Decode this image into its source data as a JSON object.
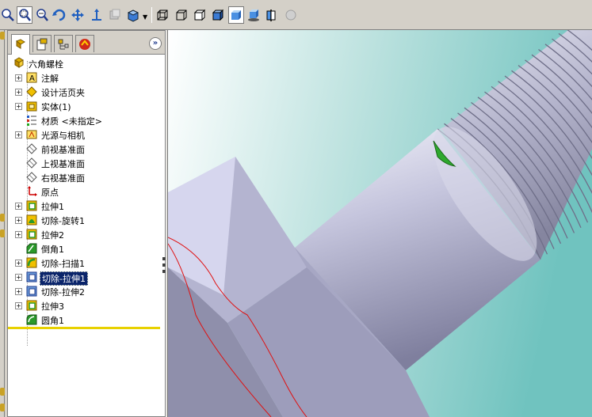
{
  "toolbar": {
    "buttons": [
      {
        "name": "zoom-to-fit-icon"
      },
      {
        "name": "zoom-to-area-icon"
      },
      {
        "name": "zoom-in-out-icon"
      },
      {
        "name": "rotate-view-icon"
      },
      {
        "name": "pan-icon"
      },
      {
        "name": "view-orientation-icon"
      },
      {
        "name": "previous-view-icon"
      },
      {
        "name": "standard-views-icon"
      },
      {
        "name": "wireframe-icon"
      },
      {
        "name": "hidden-lines-visible-icon"
      },
      {
        "name": "hidden-lines-removed-icon"
      },
      {
        "name": "shaded-with-edges-icon"
      },
      {
        "name": "shaded-icon"
      },
      {
        "name": "shadows-icon"
      },
      {
        "name": "section-view-icon"
      },
      {
        "name": "realview-icon"
      }
    ],
    "active_button": "shaded-icon"
  },
  "feature_manager": {
    "tabs": [
      "feature-tree",
      "property-manager",
      "configuration-manager",
      "display-manager"
    ],
    "root": "六角螺栓",
    "items": [
      {
        "label": "注解",
        "icon": "annotations-icon",
        "expandable": true
      },
      {
        "label": "设计活页夹",
        "icon": "design-binder-icon",
        "expandable": true
      },
      {
        "label": "实体(1)",
        "icon": "solid-bodies-icon",
        "expandable": true
      },
      {
        "label": "材质 <未指定>",
        "icon": "material-icon",
        "expandable": false
      },
      {
        "label": "光源与相机",
        "icon": "lights-cameras-icon",
        "expandable": true
      },
      {
        "label": "前视基准面",
        "icon": "plane-icon",
        "expandable": false
      },
      {
        "label": "上视基准面",
        "icon": "plane-icon",
        "expandable": false
      },
      {
        "label": "右视基准面",
        "icon": "plane-icon",
        "expandable": false
      },
      {
        "label": "原点",
        "icon": "origin-icon",
        "expandable": false
      },
      {
        "label": "拉伸1",
        "icon": "extrude-icon",
        "expandable": true
      },
      {
        "label": "切除-旋转1",
        "icon": "cut-revolve-icon",
        "expandable": true
      },
      {
        "label": "拉伸2",
        "icon": "extrude-icon",
        "expandable": true
      },
      {
        "label": "倒角1",
        "icon": "chamfer-icon",
        "expandable": false
      },
      {
        "label": "切除-扫描1",
        "icon": "cut-sweep-icon",
        "expandable": true
      },
      {
        "label": "切除-拉伸1",
        "icon": "cut-extrude-icon",
        "expandable": true,
        "selected": true
      },
      {
        "label": "切除-拉伸2",
        "icon": "cut-extrude-icon",
        "expandable": true
      },
      {
        "label": "拉伸3",
        "icon": "extrude-icon",
        "expandable": true
      },
      {
        "label": "圆角1",
        "icon": "fillet-icon",
        "expandable": false
      }
    ]
  },
  "colors": {
    "selection": "#0a246a",
    "rollback": "#e8d100",
    "viewport_bg_light": "#ffffff",
    "viewport_bg_teal": "#7fc9c6",
    "part_face": "#b8b8d6"
  }
}
